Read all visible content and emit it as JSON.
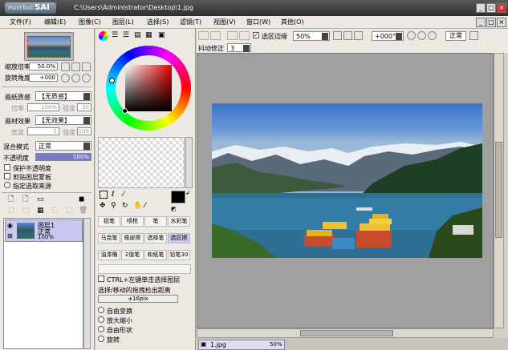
{
  "window": {
    "logo": "PaintTool",
    "app_name": "SAI",
    "path": "C:\\Users\\Administrator\\Desktop\\1.jpg"
  },
  "menu": [
    "文件(F)",
    "编辑(E)",
    "图像(C)",
    "图层(L)",
    "选择(S)",
    "滤镜(T)",
    "视图(V)",
    "窗口(W)",
    "其他(O)"
  ],
  "nav": {
    "zoom_label": "缩放倍率",
    "zoom_value": "50.0%",
    "rotate_label": "旋转角度",
    "rotate_value": "+000"
  },
  "paper": {
    "texture_label": "画纸质感",
    "texture_value": "【无质感】",
    "texture_scale": "倍率",
    "texture_scale_val": "100%",
    "texture_strength": "强度",
    "texture_strength_val": "20",
    "effect_label": "画材效果",
    "effect_value": "【无效果】",
    "effect_width": "宽度",
    "effect_width_val": "1",
    "effect_strength": "强度",
    "effect_strength_val": "100"
  },
  "blend": {
    "label": "混合模式",
    "value": "正常",
    "opacity_label": "不透明度",
    "opacity_value": "100%"
  },
  "opts": [
    "保护不透明度",
    "剪贴图层蒙板",
    "指定选取来源"
  ],
  "layer": {
    "name": "图层1",
    "mode": "正常",
    "opacity": "100%"
  },
  "tools": [
    [
      "铅笔",
      "喷枪",
      "笔",
      "水彩笔"
    ],
    [
      "马克笔",
      "橡皮擦",
      "选择笔",
      "选区擦"
    ],
    [
      "油漆桶",
      "2值笔",
      "和纸笔",
      "铅笔30"
    ]
  ],
  "ctrl": {
    "label": "CTRL+左键单击选择图层",
    "move_label": "选择/移动的拖拽检出距离",
    "move_value": "±16pix"
  },
  "transform": [
    "自由变换",
    "放大缩小",
    "自由形状",
    "旋转"
  ],
  "toolbar": {
    "antialias": "选区边缘",
    "zoom": "50%",
    "angle": "+000°",
    "mode": "正常",
    "stabilizer_label": "抖动修正",
    "stabilizer_value": "3"
  },
  "tab": {
    "name": "1.jpg",
    "zoom": "50%"
  },
  "colors": {
    "fg": "#000000",
    "bg": "#ffffff",
    "accent": "#c8c8f0"
  }
}
